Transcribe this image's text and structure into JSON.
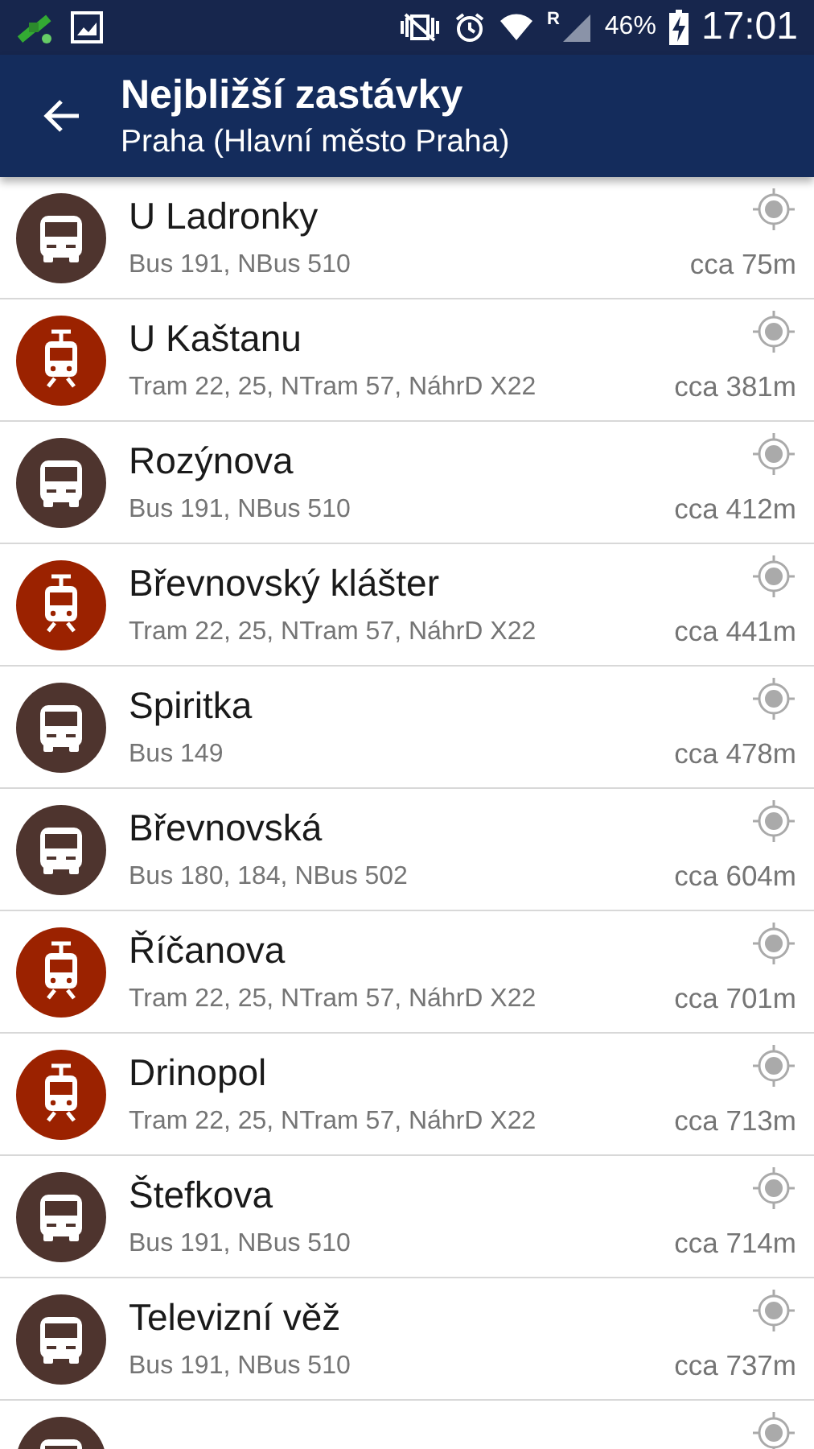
{
  "status_bar": {
    "roaming": "R",
    "battery": "46%",
    "time": "17:01"
  },
  "header": {
    "title": "Nejbližší zastávky",
    "subtitle": "Praha (Hlavní město Praha)"
  },
  "stops": [
    {
      "kind": "bus",
      "name": "U Ladronky",
      "lines": "Bus 191, NBus 510",
      "distance": "cca 75m"
    },
    {
      "kind": "tram",
      "name": "U Kaštanu",
      "lines": "Tram 22, 25, NTram 57, NáhrD X22",
      "distance": "cca 381m"
    },
    {
      "kind": "bus",
      "name": "Rozýnova",
      "lines": "Bus 191, NBus 510",
      "distance": "cca 412m"
    },
    {
      "kind": "tram",
      "name": "Břevnovský klášter",
      "lines": "Tram 22, 25, NTram 57, NáhrD X22",
      "distance": "cca 441m"
    },
    {
      "kind": "bus",
      "name": "Spiritka",
      "lines": "Bus 149",
      "distance": "cca 478m"
    },
    {
      "kind": "bus",
      "name": "Břevnovská",
      "lines": "Bus 180, 184, NBus 502",
      "distance": "cca 604m"
    },
    {
      "kind": "tram",
      "name": "Říčanova",
      "lines": "Tram 22, 25, NTram 57, NáhrD X22",
      "distance": "cca 701m"
    },
    {
      "kind": "tram",
      "name": "Drinopol",
      "lines": "Tram 22, 25, NTram 57, NáhrD X22",
      "distance": "cca 713m"
    },
    {
      "kind": "bus",
      "name": "Štefkova",
      "lines": "Bus 191, NBus 510",
      "distance": "cca 714m"
    },
    {
      "kind": "bus",
      "name": "Televizní věž",
      "lines": "Bus 191, NBus 510",
      "distance": "cca 737m"
    },
    {
      "kind": "bus"
    }
  ]
}
